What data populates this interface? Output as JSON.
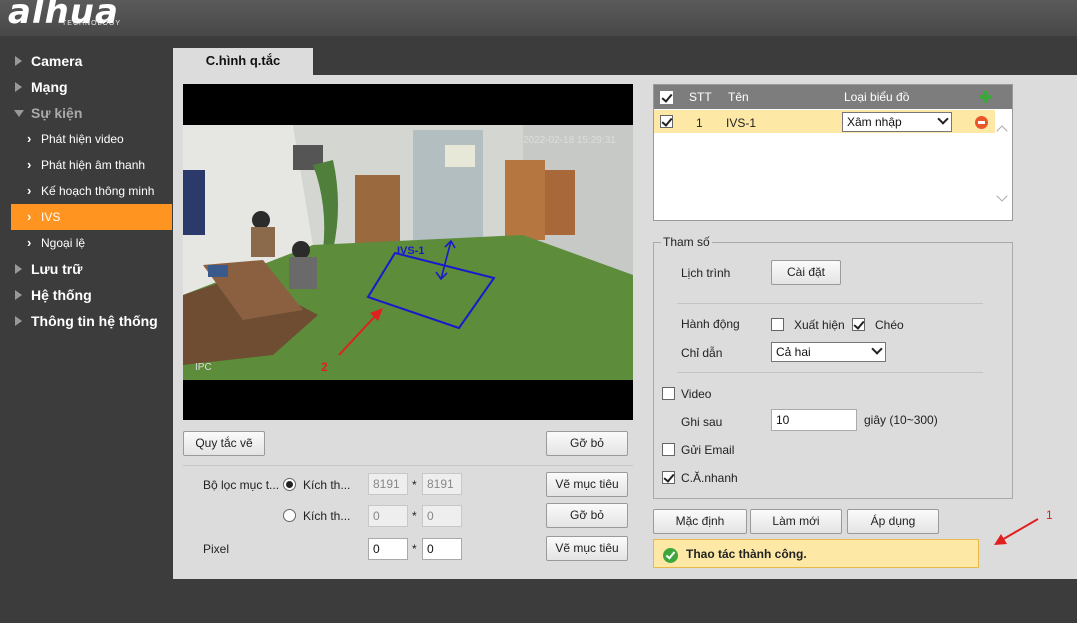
{
  "brand": {
    "logo": "alhua",
    "tagline": "TECHNOLOGY"
  },
  "sidebar": {
    "items": [
      {
        "label": "Camera"
      },
      {
        "label": "Mạng"
      },
      {
        "label": "Sự kiện"
      },
      {
        "label": "Lưu trữ"
      },
      {
        "label": "Hệ thống"
      },
      {
        "label": "Thông tin hệ thống"
      }
    ],
    "sub_items": [
      {
        "label": "Phát hiện video"
      },
      {
        "label": "Phát hiện âm thanh"
      },
      {
        "label": "Kế hoạch thông minh"
      },
      {
        "label": "IVS"
      },
      {
        "label": "Ngoại lệ"
      }
    ]
  },
  "tab": {
    "label": "C.hình q.tắc"
  },
  "video": {
    "timestamp": "2022-02-18 15:29:31",
    "camera_label": "IPC",
    "rule_name": "IVS-1",
    "marker_2": "2"
  },
  "left_controls": {
    "draw_rule": "Quy tắc vẽ",
    "remove": "Gỡ bỏ",
    "target_filter_label": "Bộ lọc mục t...",
    "size_label_1": "Kích th...",
    "size_label_2": "Kích th...",
    "pixel_label": "Pixel",
    "max_w": "8191",
    "max_h": "8191",
    "min_w": "0",
    "min_h": "0",
    "pixel_w": "0",
    "pixel_h": "0",
    "times": "*",
    "draw_target_1": "Vẽ mục tiêu",
    "remove_2": "Gỡ bỏ",
    "draw_target_2": "Vẽ mục tiêu"
  },
  "rules_table": {
    "headers": {
      "no": "STT",
      "name": "Tên",
      "type": "Loại biểu đồ"
    },
    "rows": [
      {
        "no": "1",
        "name": "IVS-1",
        "type": "Xâm nhập"
      }
    ]
  },
  "params": {
    "legend": "Tham số",
    "schedule_label": "Lịch trình",
    "setup_button": "Cài đặt",
    "action_label": "Hành động",
    "appear_label": "Xuất hiện",
    "cross_label": "Chéo",
    "direction_label": "Chỉ dẫn",
    "direction_value": "Cả hai",
    "video_label": "Video",
    "record_after_label": "Ghi sau",
    "record_after_value": "10",
    "record_after_unit": "giây (10~300)",
    "email_label": "Gửi Email",
    "snapshot_label": "C.Ă.nhanh"
  },
  "footer_buttons": {
    "default": "Mặc định",
    "refresh": "Làm mới",
    "apply": "Áp dụng"
  },
  "status": {
    "message": "Thao tác thành công."
  },
  "annotations": {
    "marker_1": "1"
  },
  "colors": {
    "accent": "#ff9420",
    "rule_line": "#1a1acc",
    "marker": "#e02020",
    "success": "#3da63d"
  }
}
